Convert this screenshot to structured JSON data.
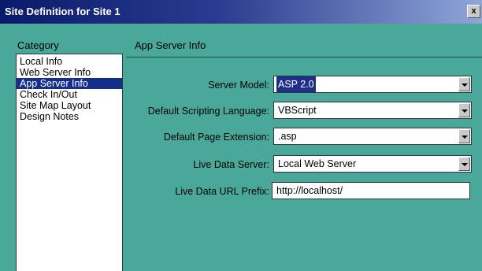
{
  "window": {
    "title": "Site Definition for Site 1",
    "close_glyph": "x"
  },
  "category": {
    "header": "Category",
    "items": [
      {
        "label": "Local Info"
      },
      {
        "label": "Web Server Info"
      },
      {
        "label": "App Server Info"
      },
      {
        "label": "Check In/Out"
      },
      {
        "label": "Site Map Layout"
      },
      {
        "label": "Design Notes"
      }
    ],
    "selected": "App Server Info"
  },
  "section": {
    "title": "App Server Info"
  },
  "form": {
    "server_model": {
      "label": "Server Model:",
      "value": "ASP 2.0"
    },
    "scripting_language": {
      "label": "Default Scripting Language:",
      "value": "VBScript"
    },
    "page_extension": {
      "label": "Default Page Extension:",
      "value": ".asp"
    },
    "live_data_server": {
      "label": "Live Data Server:",
      "value": "Local Web Server"
    },
    "live_data_url_prefix": {
      "label": "Live Data URL Prefix:",
      "value": "http://localhost/"
    }
  },
  "colors": {
    "panel_bg": "#4aa89a",
    "title_bar": "#0a1a6a",
    "selection": "#142e8c"
  }
}
